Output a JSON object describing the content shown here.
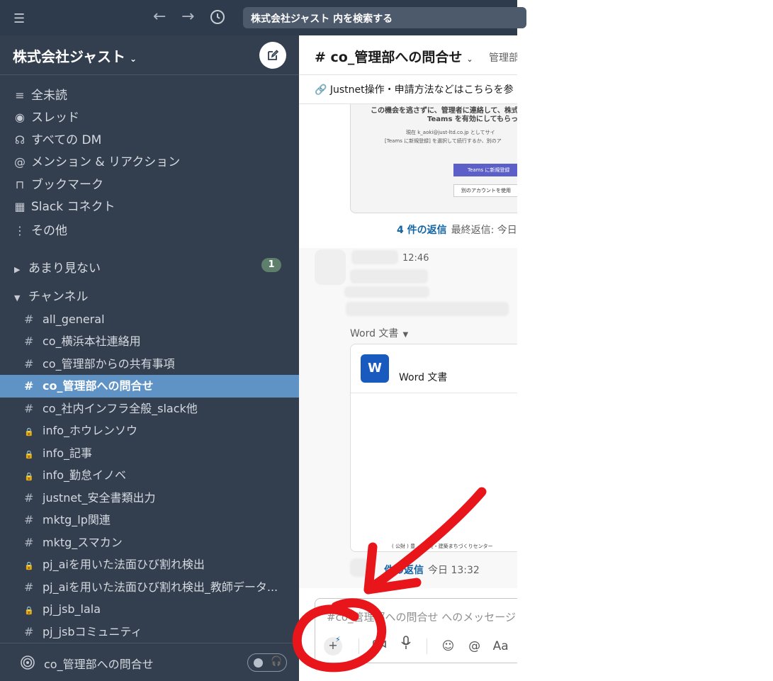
{
  "topbar": {
    "search_placeholder": "株式会社ジャスト 内を検索する"
  },
  "workspace": {
    "name": "株式会社ジャスト"
  },
  "sidebar": {
    "nav": [
      {
        "label": "全未読",
        "icon": "≡"
      },
      {
        "label": "スレッド",
        "icon": "◉"
      },
      {
        "label": "すべての DM",
        "icon": "☊"
      },
      {
        "label": "メンション & リアクション",
        "icon": "@"
      },
      {
        "label": "ブックマーク",
        "icon": "⊓"
      },
      {
        "label": "Slack コネクト",
        "icon": "▦"
      },
      {
        "label": "その他",
        "icon": "⋮"
      }
    ],
    "section_rarely": {
      "label": "あまり見ない",
      "badge": "1"
    },
    "section_channels": {
      "label": "チャンネル"
    },
    "channels": [
      {
        "name": "all_general",
        "icon": "#"
      },
      {
        "name": "co_横浜本社連絡用",
        "icon": "#"
      },
      {
        "name": "co_管理部からの共有事項",
        "icon": "#"
      },
      {
        "name": "co_管理部への問合せ",
        "icon": "#"
      },
      {
        "name": "co_社内インフラ全般_slack他",
        "icon": "#"
      },
      {
        "name": "info_ホウレンソウ",
        "icon": "🔒"
      },
      {
        "name": "info_記事",
        "icon": "🔒"
      },
      {
        "name": "info_勤怠イノベ",
        "icon": "🔒"
      },
      {
        "name": "justnet_安全書類出力",
        "icon": "#"
      },
      {
        "name": "mktg_lp関連",
        "icon": "#"
      },
      {
        "name": "mktg_スマカン",
        "icon": "#"
      },
      {
        "name": "pj_aiを用いた法面ひび割れ検出",
        "icon": "🔒"
      },
      {
        "name": "pj_aiを用いた法面ひび割れ検出_教師データ...",
        "icon": "#"
      },
      {
        "name": "pj_jsb_lala",
        "icon": "🔒"
      },
      {
        "name": "pj_jsbコミュニティ",
        "icon": "#"
      }
    ],
    "huddle_channel": "co_管理部への問合せ"
  },
  "channel": {
    "title": "# co_管理部への問合せ",
    "topic_short": "管理部",
    "bookmark": "Justnet操作・申請方法などはこちらを参"
  },
  "messages": {
    "embedded_image_text": {
      "line1": "この機会を逃さずに、管理者に連絡して、株式",
      "line2": "Teams を有効にしてもらっ",
      "line3": "現在 k_aoki@just-ltd.co.jp としてサイ",
      "line4": "[Teams に新規登録] を選択して続行するか、別のア",
      "button1": "Teams に新規登録",
      "button2": "別のアカウントを使用"
    },
    "thread1": {
      "count": "4 件の返信",
      "last": "最終返信: 今日"
    },
    "msg2_time": "12:46",
    "file_type_label": "Word 文書",
    "file_icon_letter": "W",
    "file_name": "Word 文書",
    "file_footer": "( 公財 ) 豊 … 防災・建築まちづくりセンター",
    "thread2": {
      "count": "件の返信",
      "last": "今日 13:32"
    }
  },
  "composer": {
    "placeholder": "#co_管理部への問合せ へのメッセージ",
    "tool_format": "Aa"
  },
  "colors": {
    "sidebar_bg": "#333e4e",
    "active_channel": "#5f93c6",
    "link": "#1264a3",
    "annotation": "#e8161b"
  }
}
